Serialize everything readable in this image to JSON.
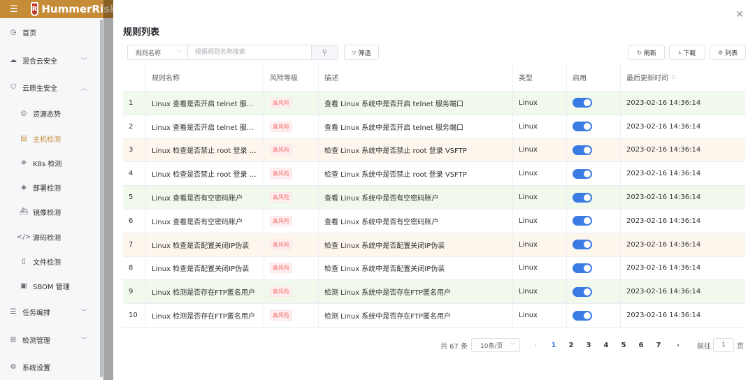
{
  "app": {
    "brand": "HummerRisk",
    "logo_letter": "R"
  },
  "sidebar": {
    "items": [
      {
        "label": "首页",
        "icon": "clock-icon",
        "glyph": "◷"
      },
      {
        "label": "混合云安全",
        "icon": "cloud-icon",
        "glyph": "☁"
      },
      {
        "label": "云原生安全",
        "icon": "shield-icon",
        "glyph": "⛉"
      },
      {
        "label": "资源态势",
        "icon": "radar-icon",
        "glyph": "◎"
      },
      {
        "label": "主机检测",
        "icon": "host-icon",
        "glyph": "▤"
      },
      {
        "label": "K8s 检测",
        "icon": "k8s-icon",
        "glyph": "✵"
      },
      {
        "label": "部署检测",
        "icon": "layers-icon",
        "glyph": "◈"
      },
      {
        "label": "镜像检测",
        "icon": "ship-icon",
        "glyph": "⛴"
      },
      {
        "label": "源码检测",
        "icon": "code-icon",
        "glyph": "</>"
      },
      {
        "label": "文件检测",
        "icon": "file-icon",
        "glyph": "▯"
      },
      {
        "label": "SBOM 管理",
        "icon": "box-icon",
        "glyph": "▣"
      },
      {
        "label": "任务编排",
        "icon": "list-icon",
        "glyph": "☰"
      },
      {
        "label": "检测管理",
        "icon": "grid-icon",
        "glyph": "⊞"
      },
      {
        "label": "系统设置",
        "icon": "gear-icon",
        "glyph": "⚙"
      }
    ]
  },
  "drawer": {
    "title": "规则列表",
    "close_glyph": "✕"
  },
  "search": {
    "field_select": "规则名称",
    "placeholder": "根据规则名称搜索",
    "filter_label": "筛选"
  },
  "toolbar": {
    "refresh_label": "刷新",
    "download_label": "下载",
    "columns_label": "列表"
  },
  "table": {
    "headers": [
      "",
      "规则名称",
      "风险等级",
      "描述",
      "类型",
      "启用",
      "最后更新时间"
    ],
    "rows": [
      {
        "index": "1",
        "name": "Linux 查看是否开启 telnet 服务…",
        "risk": "高风险",
        "desc": "查看 Linux 系统中是否开启 telnet 服务端口",
        "type": "Linux",
        "enabled": true,
        "updated": "2023-02-16 14:36:14",
        "tone": "green"
      },
      {
        "index": "2",
        "name": "Linux 查看是否开启 telnet 服务…",
        "risk": "高风险",
        "desc": "查看 Linux 系统中是否开启 telnet 服务端口",
        "type": "Linux",
        "enabled": true,
        "updated": "2023-02-16 14:36:14",
        "tone": ""
      },
      {
        "index": "3",
        "name": "Linux 检查是否禁止 root 登录 VS…",
        "risk": "高风险",
        "desc": "检查 Linux 系统中是否禁止 root 登录 VSFTP",
        "type": "Linux",
        "enabled": true,
        "updated": "2023-02-16 14:36:14",
        "tone": "orange"
      },
      {
        "index": "4",
        "name": "Linux 检查是否禁止 root 登录 VS…",
        "risk": "高风险",
        "desc": "检查 Linux 系统中是否禁止 root 登录 VSFTP",
        "type": "Linux",
        "enabled": true,
        "updated": "2023-02-16 14:36:14",
        "tone": ""
      },
      {
        "index": "5",
        "name": "Linux 查看是否有空密码账户",
        "risk": "高风险",
        "desc": "查看 Linux 系统中是否有空密码账户",
        "type": "Linux",
        "enabled": true,
        "updated": "2023-02-16 14:36:14",
        "tone": "green"
      },
      {
        "index": "6",
        "name": "Linux 查看是否有空密码账户",
        "risk": "高风险",
        "desc": "查看 Linux 系统中是否有空密码账户",
        "type": "Linux",
        "enabled": true,
        "updated": "2023-02-16 14:36:14",
        "tone": ""
      },
      {
        "index": "7",
        "name": "Linux 检查是否配置关闭IP伪装",
        "risk": "高风险",
        "desc": "检查 Linux 系统中是否配置关闭IP伪装",
        "type": "Linux",
        "enabled": true,
        "updated": "2023-02-16 14:36:14",
        "tone": "orange"
      },
      {
        "index": "8",
        "name": "Linux 检查是否配置关闭IP伪装",
        "risk": "高风险",
        "desc": "检查 Linux 系统中是否配置关闭IP伪装",
        "type": "Linux",
        "enabled": true,
        "updated": "2023-02-16 14:36:14",
        "tone": ""
      },
      {
        "index": "9",
        "name": "Linux 检测是否存在FTP匿名用户",
        "risk": "高风险",
        "desc": "检测 Linux 系统中是否存在FTP匿名用户",
        "type": "Linux",
        "enabled": true,
        "updated": "2023-02-16 14:36:14",
        "tone": "green"
      },
      {
        "index": "10",
        "name": "Linux 检测是否存在FTP匿名用户",
        "risk": "高风险",
        "desc": "检测 Linux 系统中是否存在FTP匿名用户",
        "type": "Linux",
        "enabled": true,
        "updated": "2023-02-16 14:36:14",
        "tone": ""
      }
    ]
  },
  "pagination": {
    "total_text": "共 67 条",
    "page_size": "10条/页",
    "pages": [
      "1",
      "2",
      "3",
      "4",
      "5",
      "6",
      "7"
    ],
    "current": "1",
    "prev_glyph": "‹",
    "next_glyph": "›",
    "jump_prefix": "前往",
    "jump_value": "1",
    "jump_suffix": "页"
  },
  "colors": {
    "brand": "#c58b37",
    "switch_on": "#3a7ce3",
    "risk_high": "#f56c6c",
    "row_green": "#f0f9eb",
    "row_orange": "#fdf6ec"
  }
}
